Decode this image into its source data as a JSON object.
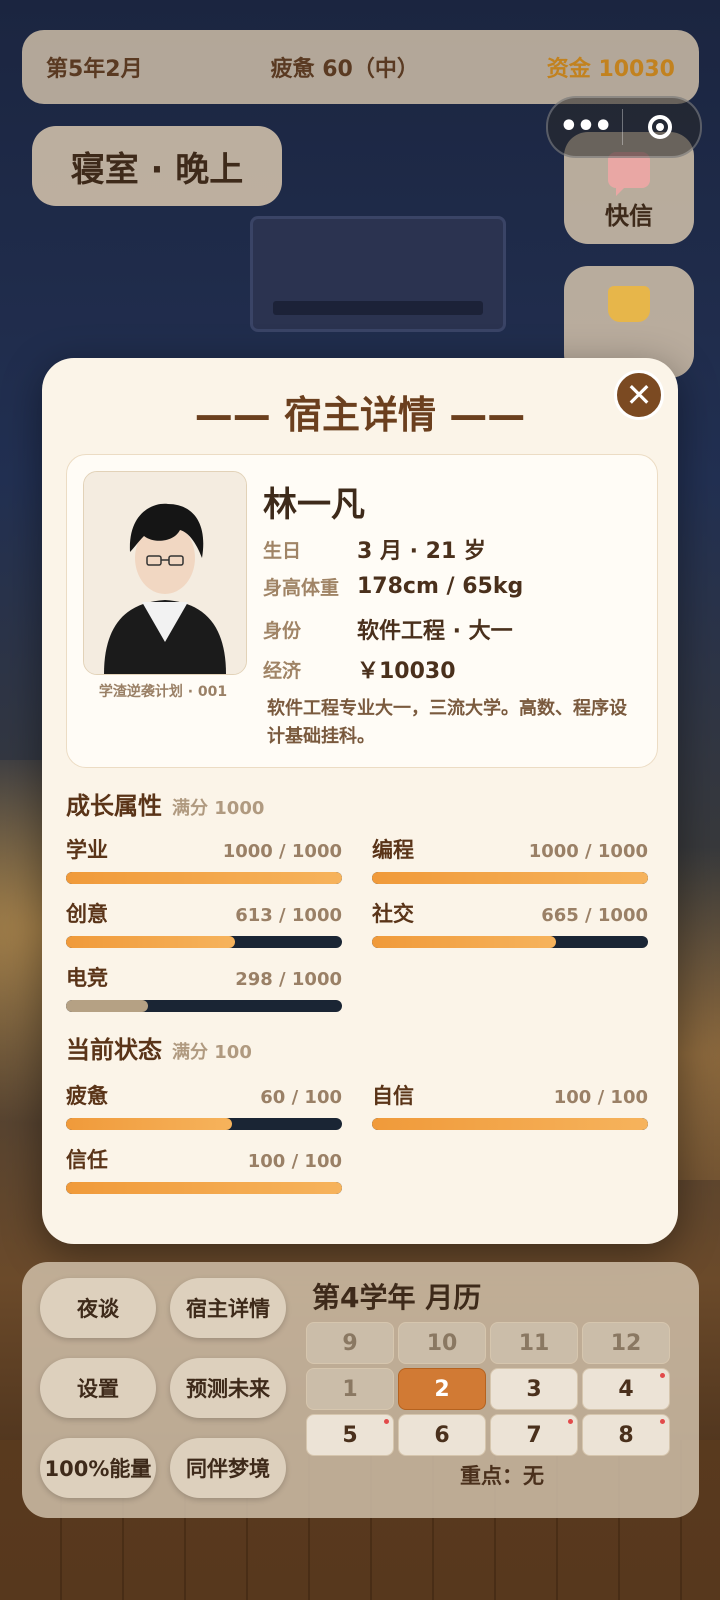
{
  "topbar": {
    "date": "第5年2月",
    "fatigue": "疲惫 60（中）",
    "funds": "资金 10030"
  },
  "location": "寝室 · 晚上",
  "capsule": {
    "more": "•••"
  },
  "side": [
    {
      "label": "快信",
      "icon": "message-icon"
    },
    {
      "label": "",
      "icon": "bag-icon"
    }
  ],
  "modal": {
    "title": "—— 宿主详情 ——",
    "profile": {
      "tag": "学渣逆袭计划 · 001",
      "name": "林一凡",
      "fields": [
        {
          "k": "生日",
          "v": "3 月 · 21 岁"
        },
        {
          "k": "身高体重",
          "v": "178cm / 65kg"
        },
        {
          "k": "身份",
          "v": "软件工程 · 大一"
        },
        {
          "k": "经济",
          "v": "￥10030"
        }
      ],
      "desc": "软件工程专业大一，三流大学。高数、程序设计基础挂科。"
    },
    "growth": {
      "title": "成长属性",
      "max": "满分 1000",
      "stats": [
        {
          "name": "学业",
          "value": 1000,
          "max": 1000,
          "text": "1000 / 1000"
        },
        {
          "name": "编程",
          "value": 1000,
          "max": 1000,
          "text": "1000 / 1000"
        },
        {
          "name": "创意",
          "value": 613,
          "max": 1000,
          "text": "613 / 1000"
        },
        {
          "name": "社交",
          "value": 665,
          "max": 1000,
          "text": "665 / 1000"
        },
        {
          "name": "电竞",
          "value": 298,
          "max": 1000,
          "text": "298 / 1000"
        }
      ]
    },
    "status": {
      "title": "当前状态",
      "max": "满分 100",
      "stats": [
        {
          "name": "疲惫",
          "value": 60,
          "max": 100,
          "text": "60 / 100"
        },
        {
          "name": "自信",
          "value": 100,
          "max": 100,
          "text": "100 / 100"
        },
        {
          "name": "信任",
          "value": 100,
          "max": 100,
          "text": "100 / 100"
        }
      ]
    }
  },
  "actions": [
    "夜谈",
    "宿主详情",
    "设置",
    "预测未来",
    "100%能量",
    "同伴梦境"
  ],
  "calendar": {
    "title": "第4学年 月历",
    "months": [
      {
        "label": "9",
        "state": "dim"
      },
      {
        "label": "10",
        "state": "dim"
      },
      {
        "label": "11",
        "state": "dim"
      },
      {
        "label": "12",
        "state": "dim"
      },
      {
        "label": "1",
        "state": "dim"
      },
      {
        "label": "2",
        "state": "today"
      },
      {
        "label": "3",
        "state": "normal"
      },
      {
        "label": "4",
        "state": "dot"
      },
      {
        "label": "5",
        "state": "dot"
      },
      {
        "label": "6",
        "state": "normal"
      },
      {
        "label": "7",
        "state": "dot"
      },
      {
        "label": "8",
        "state": "dot"
      }
    ],
    "focus": "重点：无"
  }
}
